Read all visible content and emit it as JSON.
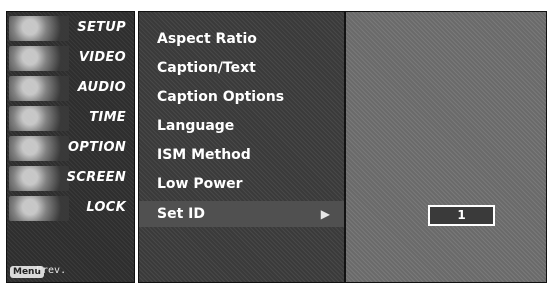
{
  "sidebar": {
    "items": [
      {
        "label": "SETUP"
      },
      {
        "label": "VIDEO"
      },
      {
        "label": "AUDIO"
      },
      {
        "label": "TIME"
      },
      {
        "label": "OPTION"
      },
      {
        "label": "SCREEN"
      },
      {
        "label": "LOCK"
      }
    ],
    "menu_key": "Menu",
    "prev_label": "Prev."
  },
  "options": {
    "items": [
      {
        "label": "Aspect Ratio"
      },
      {
        "label": "Caption/Text"
      },
      {
        "label": "Caption Options"
      },
      {
        "label": "Language"
      },
      {
        "label": "ISM Method"
      },
      {
        "label": "Low Power"
      },
      {
        "label": "Set ID"
      }
    ],
    "selected": "Set ID"
  },
  "value_panel": {
    "set_id_value": "1"
  },
  "icons": {
    "submenu_arrow": "triangle-right-icon"
  }
}
